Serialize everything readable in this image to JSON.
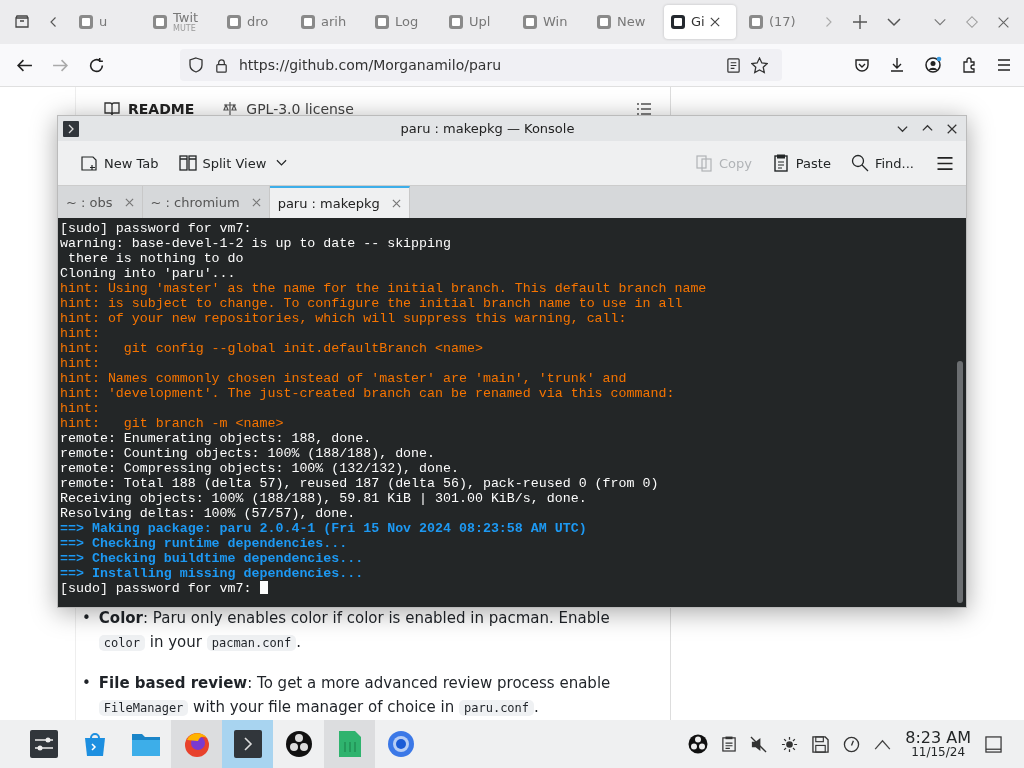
{
  "browser": {
    "tabs": [
      {
        "title": "u",
        "selected": false
      },
      {
        "title": "Twit",
        "subtitle": "MUTE",
        "selected": false
      },
      {
        "title": "dro",
        "selected": false
      },
      {
        "title": "arih",
        "selected": false
      },
      {
        "title": "Log",
        "selected": false
      },
      {
        "title": "Upl",
        "selected": false
      },
      {
        "title": "Win",
        "selected": false
      },
      {
        "title": "New",
        "selected": false
      },
      {
        "title": "Gi",
        "selected": true
      },
      {
        "title": "(17)",
        "selected": false
      }
    ],
    "url": "https://github.com/Morganamilo/paru"
  },
  "readme": {
    "tab": "README",
    "license": "GPL-3.0 license",
    "bullets": [
      {
        "marker": "•",
        "parts": [
          {
            "kind": "text",
            "text": "**Color**: Paru only enables color if color is enabled in pacman. Enable "
          },
          {
            "kind": "code",
            "text": "color"
          },
          {
            "kind": "text",
            "text": " in your "
          },
          {
            "kind": "code",
            "text": "pacman.conf"
          },
          {
            "kind": "text",
            "text": "."
          }
        ]
      },
      {
        "marker": "•",
        "parts": [
          {
            "kind": "text",
            "text": "**File based review**: To get a more advanced review process enable "
          },
          {
            "kind": "code",
            "text": "FileManager"
          },
          {
            "kind": "text",
            "text": " with your file manager of choice in "
          },
          {
            "kind": "code",
            "text": "paru.conf"
          },
          {
            "kind": "text",
            "text": "."
          }
        ]
      }
    ]
  },
  "konsole": {
    "title": "paru : makepkg — Konsole",
    "toolbar": [
      {
        "kind": "new-tab",
        "label": "New Tab",
        "disabled": false
      },
      {
        "kind": "split",
        "label": "Split View",
        "disabled": false
      },
      {
        "kind": "copy",
        "label": "Copy",
        "disabled": true
      },
      {
        "kind": "paste",
        "label": "Paste",
        "disabled": false
      },
      {
        "kind": "find",
        "label": "Find...",
        "disabled": false
      }
    ],
    "tabs": [
      {
        "label": "~ : obs",
        "selected": false
      },
      {
        "label": "~ : chromium",
        "selected": false
      },
      {
        "label": "paru : makepkg",
        "selected": true
      }
    ],
    "cursor": true,
    "lines": [
      {
        "kind": "plain",
        "text": "[sudo] password for vm7:"
      },
      {
        "kind": "plain",
        "text": "warning: base-devel-1-2 is up to date -- skipping"
      },
      {
        "kind": "plain",
        "text": " there is nothing to do"
      },
      {
        "kind": "plain",
        "text": "Cloning into 'paru'..."
      },
      {
        "kind": "hint",
        "text": "hint: Using 'master' as the name for the initial branch. This default branch name"
      },
      {
        "kind": "hint",
        "text": "hint: is subject to change. To configure the initial branch name to use in all"
      },
      {
        "kind": "hint",
        "text": "hint: of your new repositories, which will suppress this warning, call:"
      },
      {
        "kind": "hint",
        "text": "hint:"
      },
      {
        "kind": "hint",
        "text": "hint:   git config --global init.defaultBranch <name>"
      },
      {
        "kind": "hint",
        "text": "hint:"
      },
      {
        "kind": "hint",
        "text": "hint: Names commonly chosen instead of 'master' are 'main', 'trunk' and"
      },
      {
        "kind": "hint",
        "text": "hint: 'development'. The just-created branch can be renamed via this command:"
      },
      {
        "kind": "hint",
        "text": "hint:"
      },
      {
        "kind": "hint",
        "text": "hint:   git branch -m <name>"
      },
      {
        "kind": "plain",
        "text": "remote: Enumerating objects: 188, done."
      },
      {
        "kind": "plain",
        "text": "remote: Counting objects: 100% (188/188), done."
      },
      {
        "kind": "plain",
        "text": "remote: Compressing objects: 100% (132/132), done."
      },
      {
        "kind": "plain",
        "text": "remote: Total 188 (delta 57), reused 187 (delta 56), pack-reused 0 (from 0)"
      },
      {
        "kind": "plain",
        "text": "Receiving objects: 100% (188/188), 59.81 KiB | 301.00 KiB/s, done."
      },
      {
        "kind": "plain",
        "text": "Resolving deltas: 100% (57/57), done."
      },
      {
        "kind": "step",
        "text": "==> Making package: paru 2.0.4-1 (Fri 15 Nov 2024 08:23:58 AM UTC)"
      },
      {
        "kind": "step",
        "text": "==> Checking runtime dependencies..."
      },
      {
        "kind": "step",
        "text": "==> Checking buildtime dependencies..."
      },
      {
        "kind": "step",
        "text": "==> Installing missing dependencies..."
      },
      {
        "kind": "plain",
        "text": "[sudo] password for vm7:"
      }
    ]
  },
  "taskbar": {
    "items": [
      {
        "kind": "sliders",
        "running": false,
        "selected": false
      },
      {
        "kind": "bag",
        "running": false,
        "selected": false
      },
      {
        "kind": "folder",
        "running": false,
        "selected": false
      },
      {
        "kind": "globe",
        "running": true,
        "selected": false
      },
      {
        "kind": "terminal",
        "running": true,
        "selected": true
      },
      {
        "kind": "aperture",
        "running": false,
        "selected": false
      },
      {
        "kind": "sheet",
        "running": true,
        "selected": false
      },
      {
        "kind": "ring",
        "running": false,
        "selected": false
      }
    ],
    "time": "8:23 AM",
    "date": "11/15/24"
  }
}
